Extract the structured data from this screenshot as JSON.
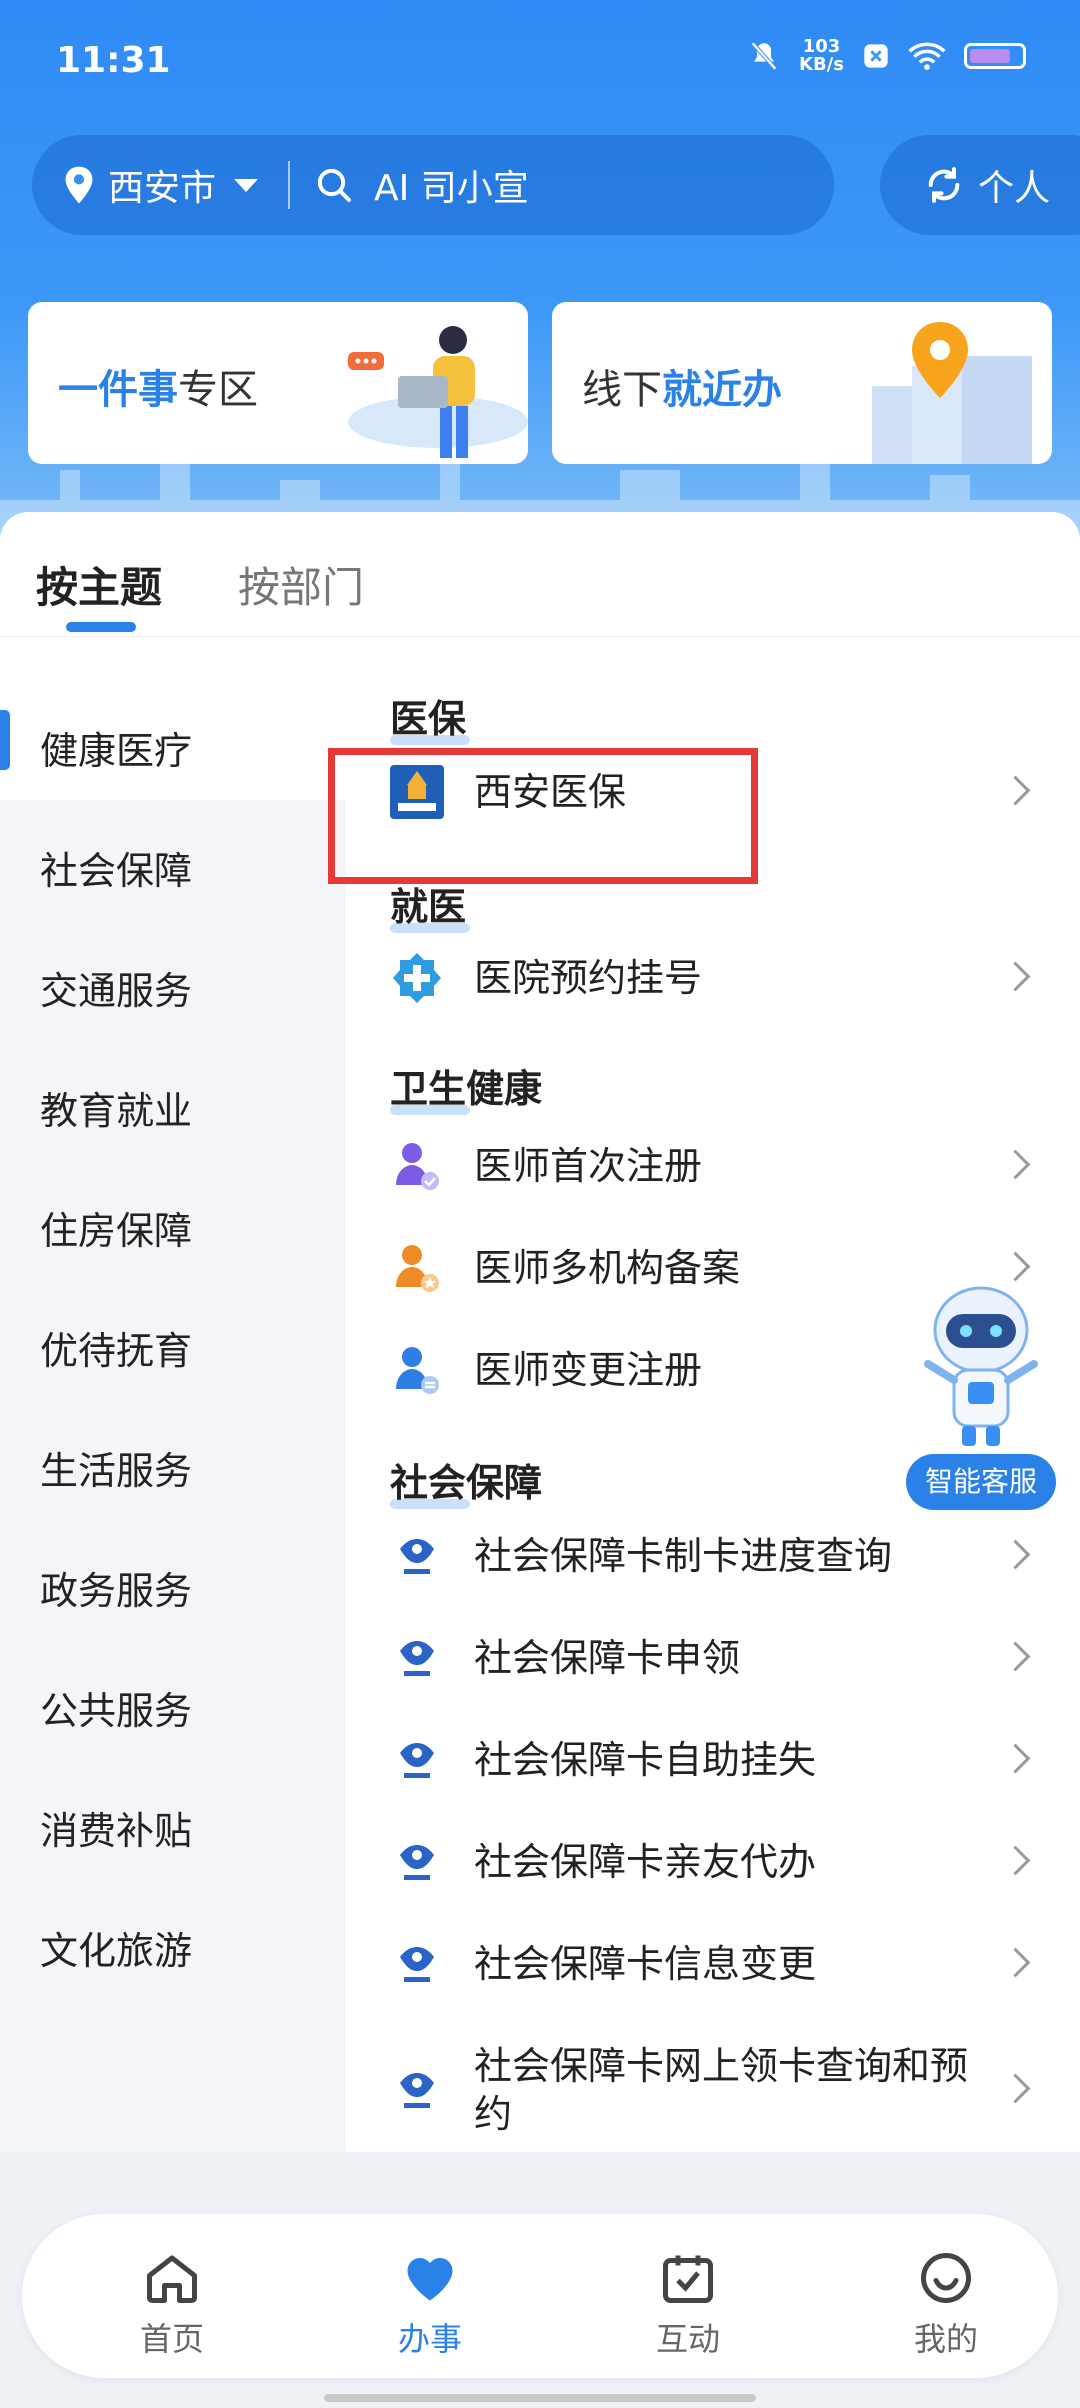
{
  "status_bar": {
    "time": "11:31",
    "speed_value": "103",
    "speed_unit": "KB/s"
  },
  "header": {
    "city": "西安市",
    "search_placeholder": "AI 司小宣",
    "personal_label": "个人"
  },
  "entry_cards": {
    "card1": {
      "highlight": "一件事",
      "rest": "专区"
    },
    "card2": {
      "prefix": "线下",
      "highlight": "就近办"
    }
  },
  "tabs": {
    "active": "按主题",
    "inactive": "按部门"
  },
  "sidebar": {
    "items": [
      "健康医疗",
      "社会保障",
      "交通服务",
      "教育就业",
      "住房保障",
      "优待抚育",
      "生活服务",
      "政务服务",
      "公共服务",
      "消费补贴",
      "文化旅游"
    ]
  },
  "content": {
    "sections": [
      {
        "title": "医保",
        "items": [
          "西安医保"
        ]
      },
      {
        "title": "就医",
        "items": [
          "医院预约挂号"
        ]
      },
      {
        "title": "卫生健康",
        "items": [
          "医师首次注册",
          "医师多机构备案",
          "医师变更注册"
        ]
      },
      {
        "title": "社会保障",
        "items": [
          "社会保障卡制卡进度查询",
          "社会保障卡申领",
          "社会保障卡自助挂失",
          "社会保障卡亲友代办",
          "社会保障卡信息变更",
          "社会保障卡网上领卡查询和预约"
        ]
      }
    ]
  },
  "assistant": {
    "label": "智能客服"
  },
  "bottom_nav": {
    "items": [
      "首页",
      "办事",
      "互动",
      "我的"
    ],
    "active_index": 1
  },
  "colors": {
    "accent": "#2a82e8",
    "highlight_box": "#e53935",
    "header_bg": "#3d98f7"
  }
}
